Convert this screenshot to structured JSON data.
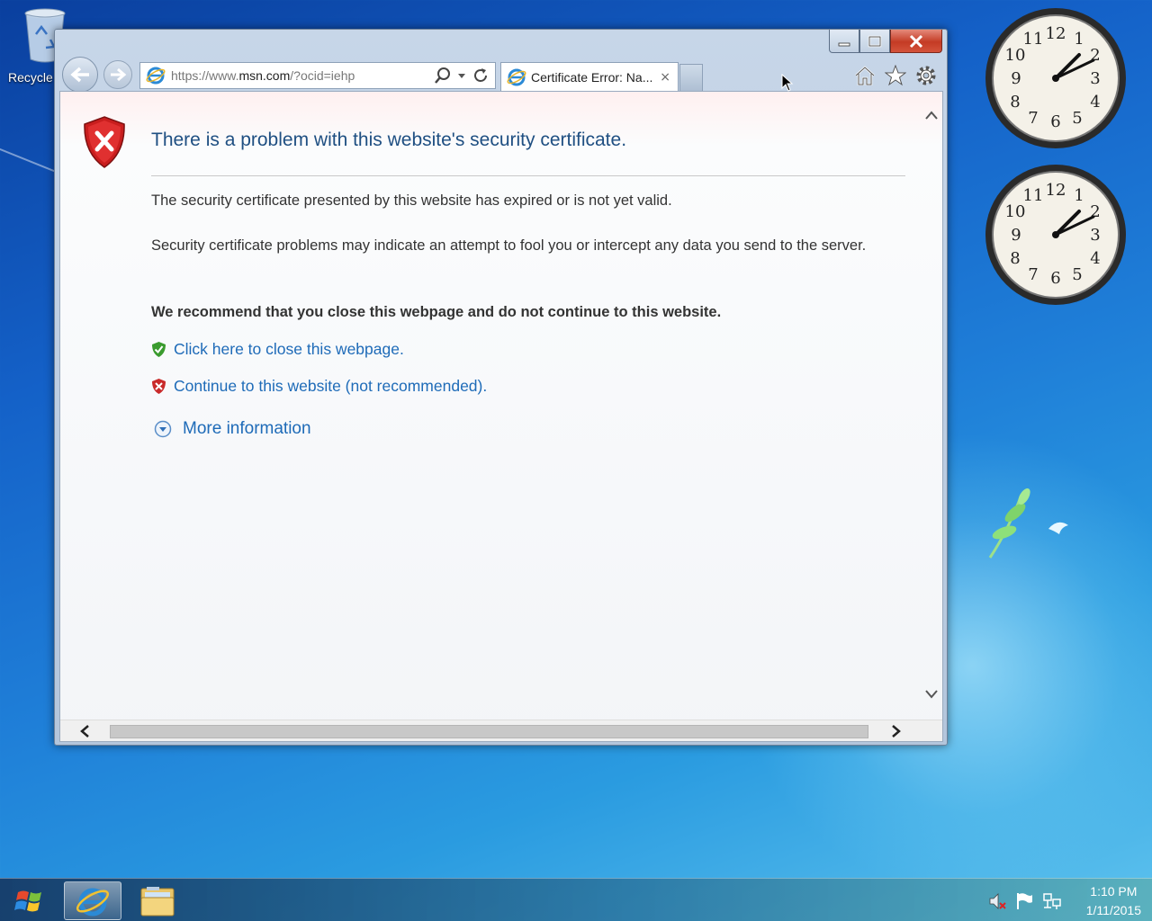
{
  "desktop": {
    "recycle_bin_label": "Recycle"
  },
  "browser": {
    "address_url_prefix": "https://www.",
    "address_url_domain": "msn.com",
    "address_url_suffix": "/?ocid=iehp",
    "tab_title": "Certificate Error: Na...",
    "tab_close": "×"
  },
  "page": {
    "title": "There is a problem with this website's security certificate.",
    "para1": "The security certificate presented by this website has expired or is not yet valid.",
    "para2": "Security certificate problems may indicate an attempt to fool you or intercept any data you send to the server.",
    "recommend": "We recommend that you close this webpage and do not continue to this website.",
    "close_link": "Click here to close this webpage.",
    "continue_link": "Continue to this website (not recommended).",
    "more_info": "More information"
  },
  "taskbar": {
    "time": "1:10 PM",
    "date": "1/11/2015"
  },
  "colors": {
    "link": "#1e6bb8",
    "title": "#1f4f82",
    "close_button": "#c43b24"
  }
}
